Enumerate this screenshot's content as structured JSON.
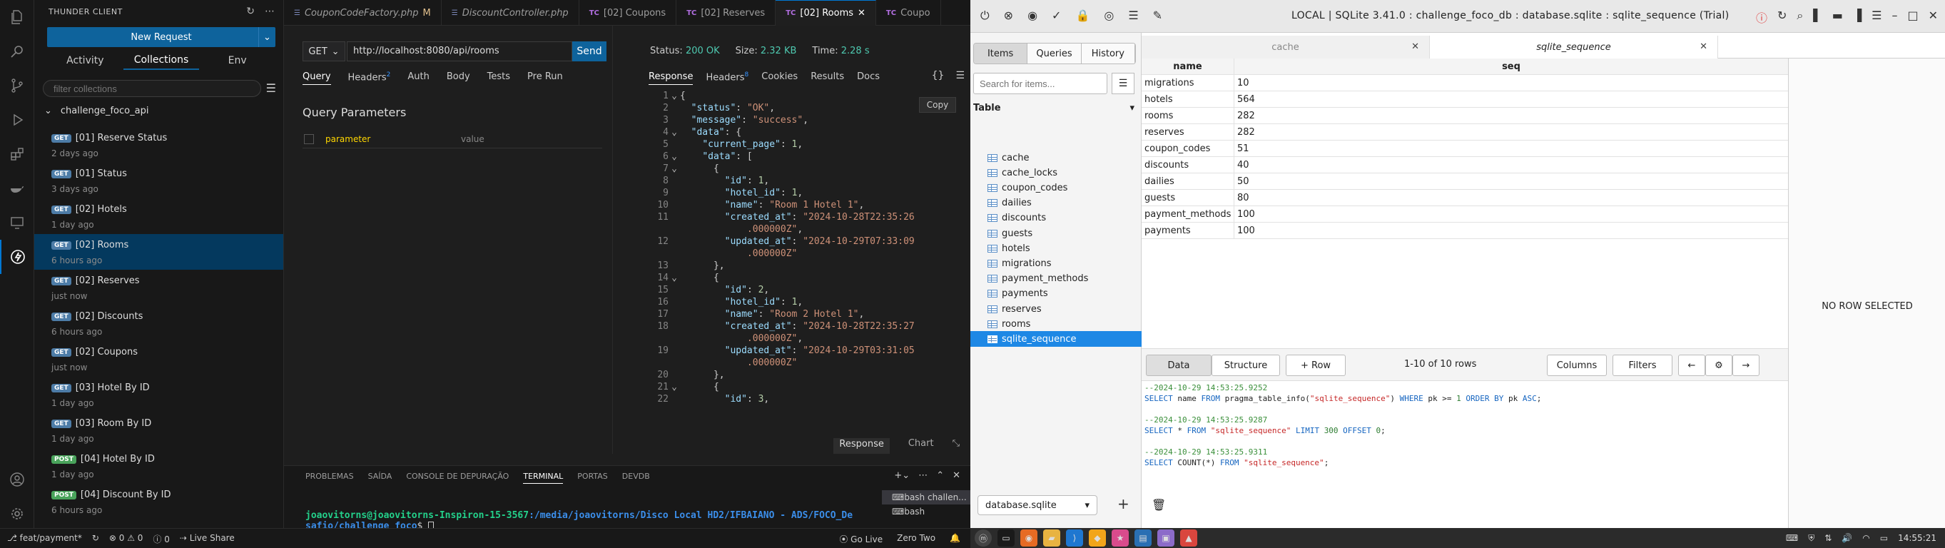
{
  "vscode": {
    "sidebar": {
      "title": "THUNDER CLIENT",
      "new_request": "New Request",
      "tabs": [
        "Activity",
        "Collections",
        "Env"
      ],
      "filter_placeholder": "filter collections",
      "collection": "challenge_foco_api",
      "requests": [
        {
          "method": "GET",
          "name": "[01] Reserve Status",
          "time": "2 days ago"
        },
        {
          "method": "GET",
          "name": "[01] Status",
          "time": "3 days ago"
        },
        {
          "method": "GET",
          "name": "[02] Hotels",
          "time": "1 day ago"
        },
        {
          "method": "GET",
          "name": "[02] Rooms",
          "time": "6 hours ago",
          "selected": true
        },
        {
          "method": "GET",
          "name": "[02] Reserves",
          "time": "just now"
        },
        {
          "method": "GET",
          "name": "[02] Discounts",
          "time": "6 hours ago"
        },
        {
          "method": "GET",
          "name": "[02] Coupons",
          "time": "just now"
        },
        {
          "method": "GET",
          "name": "[03] Hotel By ID",
          "time": "1 day ago"
        },
        {
          "method": "GET",
          "name": "[03] Room By ID",
          "time": "1 day ago"
        },
        {
          "method": "POST",
          "name": "[04] Hotel By ID",
          "time": "1 day ago"
        },
        {
          "method": "POST",
          "name": "[04] Discount By ID",
          "time": "6 hours ago"
        }
      ]
    },
    "tabs": [
      {
        "icon": "php",
        "label": "CouponCodeFactory.php",
        "suffix": "M"
      },
      {
        "icon": "php",
        "label": "DiscountController.php"
      },
      {
        "icon": "TC",
        "label": "[02] Coupons"
      },
      {
        "icon": "TC",
        "label": "[02] Reserves"
      },
      {
        "icon": "TC",
        "label": "[02] Rooms",
        "active": true
      },
      {
        "icon": "TC",
        "label": "Coupo"
      }
    ],
    "request": {
      "method": "GET",
      "url": "http://localhost:8080/api/rooms",
      "send": "Send",
      "tabs": [
        "Query",
        "Headers",
        "Auth",
        "Body",
        "Tests",
        "Pre Run"
      ],
      "headers_count": "2",
      "query_title": "Query Parameters",
      "param_placeholder": "parameter",
      "value_placeholder": "value"
    },
    "response": {
      "status_label": "Status:",
      "status": "200 OK",
      "size_label": "Size:",
      "size": "2.32 KB",
      "time_label": "Time:",
      "time": "2.28 s",
      "tabs": [
        "Response",
        "Headers",
        "Cookies",
        "Results",
        "Docs"
      ],
      "headers_count": "8",
      "copy": "Copy",
      "footer": [
        "Response",
        "Chart"
      ],
      "lines": [
        {
          "n": "1",
          "f": "v",
          "t": "{"
        },
        {
          "n": "2",
          "f": "",
          "t": "  \"status\": \"OK\","
        },
        {
          "n": "3",
          "f": "",
          "t": "  \"message\": \"success\","
        },
        {
          "n": "4",
          "f": "v",
          "t": "  \"data\": {"
        },
        {
          "n": "5",
          "f": "",
          "t": "    \"current_page\": 1,"
        },
        {
          "n": "6",
          "f": "v",
          "t": "    \"data\": ["
        },
        {
          "n": "7",
          "f": "v",
          "t": "      {"
        },
        {
          "n": "8",
          "f": "",
          "t": "        \"id\": 1,"
        },
        {
          "n": "9",
          "f": "",
          "t": "        \"hotel_id\": 1,"
        },
        {
          "n": "10",
          "f": "",
          "t": "        \"name\": \"Room 1 Hotel 1\","
        },
        {
          "n": "11",
          "f": "",
          "t": "        \"created_at\": \"2024-10-28T22:35:26"
        },
        {
          "n": "",
          "f": "",
          "t": "            .000000Z\","
        },
        {
          "n": "12",
          "f": "",
          "t": "        \"updated_at\": \"2024-10-29T07:33:09"
        },
        {
          "n": "",
          "f": "",
          "t": "            .000000Z\""
        },
        {
          "n": "13",
          "f": "",
          "t": "      },"
        },
        {
          "n": "14",
          "f": "v",
          "t": "      {"
        },
        {
          "n": "15",
          "f": "",
          "t": "        \"id\": 2,"
        },
        {
          "n": "16",
          "f": "",
          "t": "        \"hotel_id\": 1,"
        },
        {
          "n": "17",
          "f": "",
          "t": "        \"name\": \"Room 2 Hotel 1\","
        },
        {
          "n": "18",
          "f": "",
          "t": "        \"created_at\": \"2024-10-28T22:35:27"
        },
        {
          "n": "",
          "f": "",
          "t": "            .000000Z\","
        },
        {
          "n": "19",
          "f": "",
          "t": "        \"updated_at\": \"2024-10-29T03:31:05"
        },
        {
          "n": "",
          "f": "",
          "t": "            .000000Z\""
        },
        {
          "n": "20",
          "f": "",
          "t": "      },"
        },
        {
          "n": "21",
          "f": "v",
          "t": "      {"
        },
        {
          "n": "22",
          "f": "",
          "t": "        \"id\": 3,"
        }
      ]
    },
    "panel": {
      "tabs": [
        "PROBLEMAS",
        "SAÍDA",
        "CONSOLE DE DEPURAÇÃO",
        "TERMINAL",
        "PORTAS",
        "DEVDB"
      ],
      "active": "TERMINAL",
      "prompt_user": "joaovitorns@joaovitorns-Inspiron-15-3567",
      "prompt_path": ":/media/joaovitorns/Disco Local HD2/IFBAIANO - ADS/FOCO_De",
      "prompt_path2": "safio/challenge_foco",
      "prompt_end": "$ ",
      "terminals": [
        "bash challen...",
        "bash"
      ]
    },
    "statusbar": {
      "branch": "feat/payment*",
      "errors": "0",
      "warnings": "0",
      "info": "0",
      "live_share": "Live Share",
      "go_live": "Go Live",
      "zero_two": "Zero Two"
    }
  },
  "sqlite": {
    "title": "LOCAL | SQLite 3.41.0 : challenge_foco_db : database.sqlite : sqlite_sequence (Trial)",
    "segs": [
      "Items",
      "Queries",
      "History"
    ],
    "search_placeholder": "Search for items...",
    "section": "Table",
    "tables": [
      "cache",
      "cache_locks",
      "coupon_codes",
      "dailies",
      "discounts",
      "guests",
      "hotels",
      "migrations",
      "payment_methods",
      "payments",
      "reserves",
      "rooms",
      "sqlite_sequence"
    ],
    "selected_table": "sqlite_sequence",
    "db": "database.sqlite",
    "tabs": [
      "cache",
      "sqlite_sequence"
    ],
    "columns": [
      "name",
      "seq"
    ],
    "rows": [
      [
        "migrations",
        "10"
      ],
      [
        "hotels",
        "564"
      ],
      [
        "rooms",
        "282"
      ],
      [
        "reserves",
        "282"
      ],
      [
        "coupon_codes",
        "51"
      ],
      [
        "discounts",
        "40"
      ],
      [
        "dailies",
        "50"
      ],
      [
        "guests",
        "80"
      ],
      [
        "payment_methods",
        "100"
      ],
      [
        "payments",
        "100"
      ]
    ],
    "no_row": "NO ROW SELECTED",
    "toolbar": {
      "data": "Data",
      "structure": "Structure",
      "add_row": "+ Row",
      "count": "1-10 of 10 rows",
      "columns": "Columns",
      "filters": "Filters"
    },
    "log": [
      {
        "c": "--2024-10-29 14:53:25.9252"
      },
      {
        "sql": [
          [
            "kw",
            "SELECT "
          ],
          [
            "t",
            "name "
          ],
          [
            "kw",
            "FROM "
          ],
          [
            "t",
            "pragma_table_info("
          ],
          [
            "st",
            "\"sqlite_sequence\""
          ],
          [
            "t",
            ") "
          ],
          [
            "kw",
            "WHERE "
          ],
          [
            "t",
            "pk >= "
          ],
          [
            "nm",
            "1"
          ],
          [
            "kw",
            " ORDER BY "
          ],
          [
            "t",
            "pk "
          ],
          [
            "kw",
            "ASC"
          ],
          [
            "t",
            ";"
          ]
        ]
      },
      {
        "blank": true
      },
      {
        "c": "--2024-10-29 14:53:25.9287"
      },
      {
        "sql": [
          [
            "kw",
            "SELECT "
          ],
          [
            "t",
            "* "
          ],
          [
            "kw",
            "FROM "
          ],
          [
            "st",
            "\"sqlite_sequence\""
          ],
          [
            "kw",
            " LIMIT "
          ],
          [
            "nm",
            "300"
          ],
          [
            "kw",
            " OFFSET "
          ],
          [
            "nm",
            "0"
          ],
          [
            "t",
            ";"
          ]
        ]
      },
      {
        "blank": true
      },
      {
        "c": "--2024-10-29 14:53:25.9311"
      },
      {
        "sql": [
          [
            "kw",
            "SELECT "
          ],
          [
            "t",
            "COUNT(*) "
          ],
          [
            "kw",
            "FROM "
          ],
          [
            "st",
            "\"sqlite_sequence\""
          ],
          [
            "t",
            ";"
          ]
        ]
      }
    ]
  },
  "taskbar": {
    "clock": "14:55:21"
  }
}
